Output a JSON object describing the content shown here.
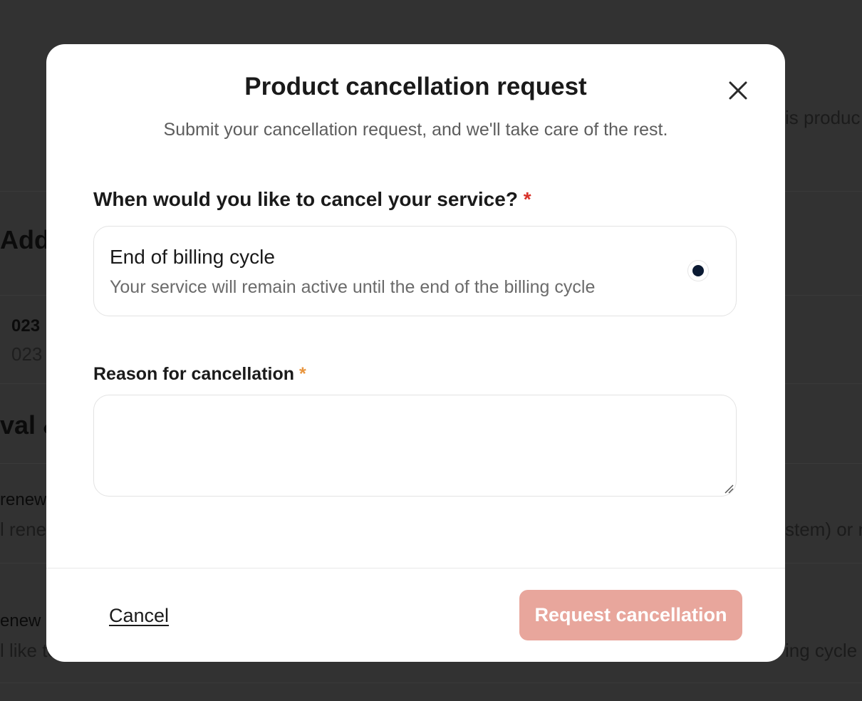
{
  "background": {
    "heading_1": "Add",
    "row_1_title": "023",
    "row_1_sub": "023",
    "heading_2": "val &",
    "right_text_1": "is produc",
    "row_2_title": "renew",
    "row_2_sub": "l renev",
    "right_text_2": "stem) or n",
    "row_3_title": "enew",
    "row_3_sub": "l like to",
    "right_text_3": "ing cycle"
  },
  "modal": {
    "title": "Product cancellation request",
    "subtitle": "Submit your cancellation request, and we'll take care of the rest.",
    "close_icon": "close-icon",
    "question_label": "When would you like to cancel your service?",
    "required_marker": "*",
    "option": {
      "title": "End of billing cycle",
      "description": "Your service will remain active until the end of the billing cycle",
      "selected": true
    },
    "reason_label": "Reason for cancellation",
    "reason_value": "",
    "cancel_label": "Cancel",
    "submit_label": "Request cancellation"
  },
  "colors": {
    "accent_disabled": "#e8a69c",
    "required_red": "#d8322a",
    "required_orange": "#e8953e",
    "radio_dot": "#0b1a33"
  }
}
